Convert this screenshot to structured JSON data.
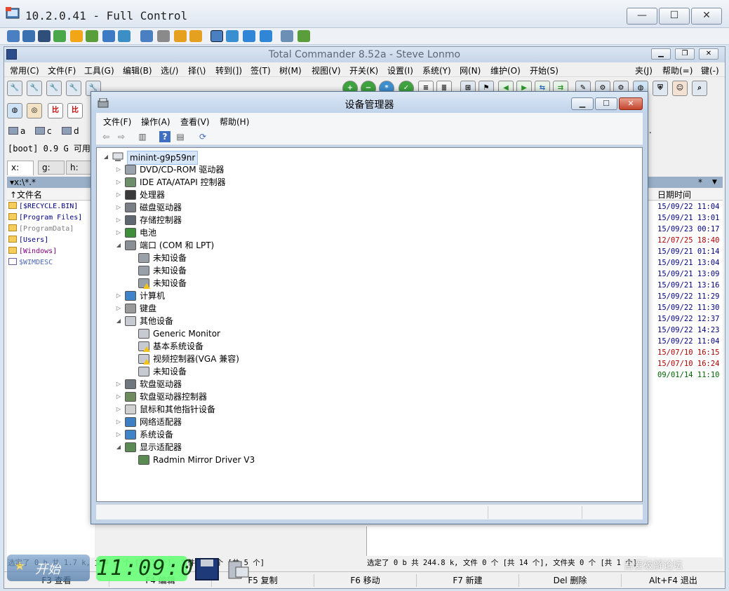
{
  "remote": {
    "title": "10.2.0.41 - Full Control",
    "caption": {
      "minimize": "—",
      "maximize": "☐",
      "close": "✕"
    }
  },
  "tc": {
    "title": "Total Commander 8.52a - Steve Lonmo",
    "menu": [
      "常用(C)",
      "文件(F)",
      "工具(G)",
      "编辑(B)",
      "选(/)",
      "择(\\)",
      "转到(])",
      "签(T)",
      "树(M)",
      "视图(V)",
      "开关(K)",
      "设置(I)",
      "系统(Y)",
      "网(N)",
      "维护(O)",
      "开始(S)"
    ],
    "menu_right": [
      "夹(J)",
      "帮助(=)",
      "键(-)"
    ],
    "drives": [
      "a",
      "c",
      "d"
    ],
    "drive_dots": "..",
    "free_space": "[boot] 0.9 G 可用，共",
    "tabs": [
      "x:",
      "g:",
      "h:"
    ],
    "left": {
      "path": "▾x:\\*.*",
      "header": "↑文件名",
      "files": [
        {
          "name": "[$RECYCLE.BIN]",
          "type": "folder",
          "color": "#000080"
        },
        {
          "name": "[Program Files]",
          "type": "folder",
          "color": "#000080"
        },
        {
          "name": "[ProgramData]",
          "type": "folder",
          "color": "#808080"
        },
        {
          "name": "[Users]",
          "type": "folder",
          "color": "#000080"
        },
        {
          "name": "[Windows]",
          "type": "folder",
          "color": "#800080"
        },
        {
          "name": "$WIMDESC",
          "type": "file",
          "color": "#4f6ab5"
        }
      ]
    },
    "right": {
      "star": "*",
      "arrow": "▼",
      "header": "日期时间",
      "dates": [
        {
          "text": "15/09/22 11:04",
          "color": "#000080"
        },
        {
          "text": "15/09/21 13:01",
          "color": "#000080"
        },
        {
          "text": "15/09/23 00:17",
          "color": "#000080"
        },
        {
          "text": "12/07/25 18:40",
          "color": "#b00000"
        },
        {
          "text": "15/09/21 01:14",
          "color": "#000080"
        },
        {
          "text": "15/09/21 13:04",
          "color": "#000080"
        },
        {
          "text": "15/09/21 13:09",
          "color": "#000080"
        },
        {
          "text": "15/09/21 13:16",
          "color": "#000080"
        },
        {
          "text": "15/09/22 11:29",
          "color": "#000080"
        },
        {
          "text": "15/09/22 11:30",
          "color": "#000080"
        },
        {
          "text": "15/09/22 12:37",
          "color": "#000080"
        },
        {
          "text": "15/09/22 14:23",
          "color": "#000080"
        },
        {
          "text": "15/09/22 11:04",
          "color": "#000080"
        },
        {
          "text": "15/07/10 16:15",
          "color": "#b00000"
        },
        {
          "text": "15/07/10 16:24",
          "color": "#b00000"
        },
        {
          "text": "09/01/14 11:10",
          "color": "#006400"
        }
      ]
    },
    "status_left": "选定了 0 b 共 1.7 k, 文件 0 个 [共 1 个], 文件夹 0 个 [共 5 个]",
    "status_right": "选定了 0 b 共 244.8 k, 文件 0 个 [共 14 个], 文件夹 0 个 [共 1 个]",
    "fkeys": [
      "F3 查看",
      "F4 编辑",
      "F5 复制",
      "F6 移动",
      "F7 新建",
      "Del 删除",
      "Alt+F4 退出"
    ]
  },
  "overlay": {
    "start": "开始",
    "clock": "11:09:04",
    "watermark": "吾爱破解论坛"
  },
  "dm": {
    "title": "设备管理器",
    "menu": [
      "文件(F)",
      "操作(A)",
      "查看(V)",
      "帮助(H)"
    ],
    "root": "minint-g9p59nr",
    "nodes": [
      {
        "label": "DVD/CD-ROM 驱动器",
        "level": 1,
        "exp": "▷",
        "icon": "#9aa3ad",
        "warn": false
      },
      {
        "label": "IDE ATA/ATAPI 控制器",
        "level": 1,
        "exp": "▷",
        "icon": "#6d8f6a",
        "warn": false
      },
      {
        "label": "处理器",
        "level": 1,
        "exp": "▷",
        "icon": "#3a3a3a",
        "warn": false
      },
      {
        "label": "磁盘驱动器",
        "level": 1,
        "exp": "▷",
        "icon": "#7a7f86",
        "warn": false
      },
      {
        "label": "存储控制器",
        "level": 1,
        "exp": "▷",
        "icon": "#5f6770",
        "warn": false
      },
      {
        "label": "电池",
        "level": 1,
        "exp": "▷",
        "icon": "#3f8f3a",
        "warn": false
      },
      {
        "label": "端口 (COM 和 LPT)",
        "level": 1,
        "exp": "◢",
        "icon": "#8a8f96",
        "warn": false
      },
      {
        "label": "未知设备",
        "level": 2,
        "exp": "",
        "icon": "#9aa0a8",
        "warn": false
      },
      {
        "label": "未知设备",
        "level": 2,
        "exp": "",
        "icon": "#9aa0a8",
        "warn": false
      },
      {
        "label": "未知设备",
        "level": 2,
        "exp": "",
        "icon": "#9aa0a8",
        "warn": true
      },
      {
        "label": "计算机",
        "level": 1,
        "exp": "▷",
        "icon": "#3f84c9",
        "warn": false
      },
      {
        "label": "键盘",
        "level": 1,
        "exp": "▷",
        "icon": "#9a9a9a",
        "warn": false
      },
      {
        "label": "其他设备",
        "level": 1,
        "exp": "◢",
        "icon": "#c7cbd1",
        "warn": false
      },
      {
        "label": "Generic Monitor",
        "level": 2,
        "exp": "",
        "icon": "#c7cbd1",
        "warn": false
      },
      {
        "label": "基本系统设备",
        "level": 2,
        "exp": "",
        "icon": "#c7cbd1",
        "warn": true
      },
      {
        "label": "视频控制器(VGA 兼容)",
        "level": 2,
        "exp": "",
        "icon": "#c7cbd1",
        "warn": true
      },
      {
        "label": "未知设备",
        "level": 2,
        "exp": "",
        "icon": "#c7cbd1",
        "warn": false
      },
      {
        "label": "软盘驱动器",
        "level": 1,
        "exp": "▷",
        "icon": "#6f767e",
        "warn": false
      },
      {
        "label": "软盘驱动器控制器",
        "level": 1,
        "exp": "▷",
        "icon": "#6f8a5c",
        "warn": false
      },
      {
        "label": "鼠标和其他指针设备",
        "level": 1,
        "exp": "▷",
        "icon": "#d0d0d0",
        "warn": false
      },
      {
        "label": "网络适配器",
        "level": 1,
        "exp": "▷",
        "icon": "#3d7fc4",
        "warn": false
      },
      {
        "label": "系统设备",
        "level": 1,
        "exp": "▷",
        "icon": "#3f84c9",
        "warn": false
      },
      {
        "label": "显示适配器",
        "level": 1,
        "exp": "◢",
        "icon": "#5b8a55",
        "warn": false
      },
      {
        "label": "Radmin Mirror Driver V3",
        "level": 2,
        "exp": "",
        "icon": "#5b8a55",
        "warn": false
      }
    ]
  }
}
